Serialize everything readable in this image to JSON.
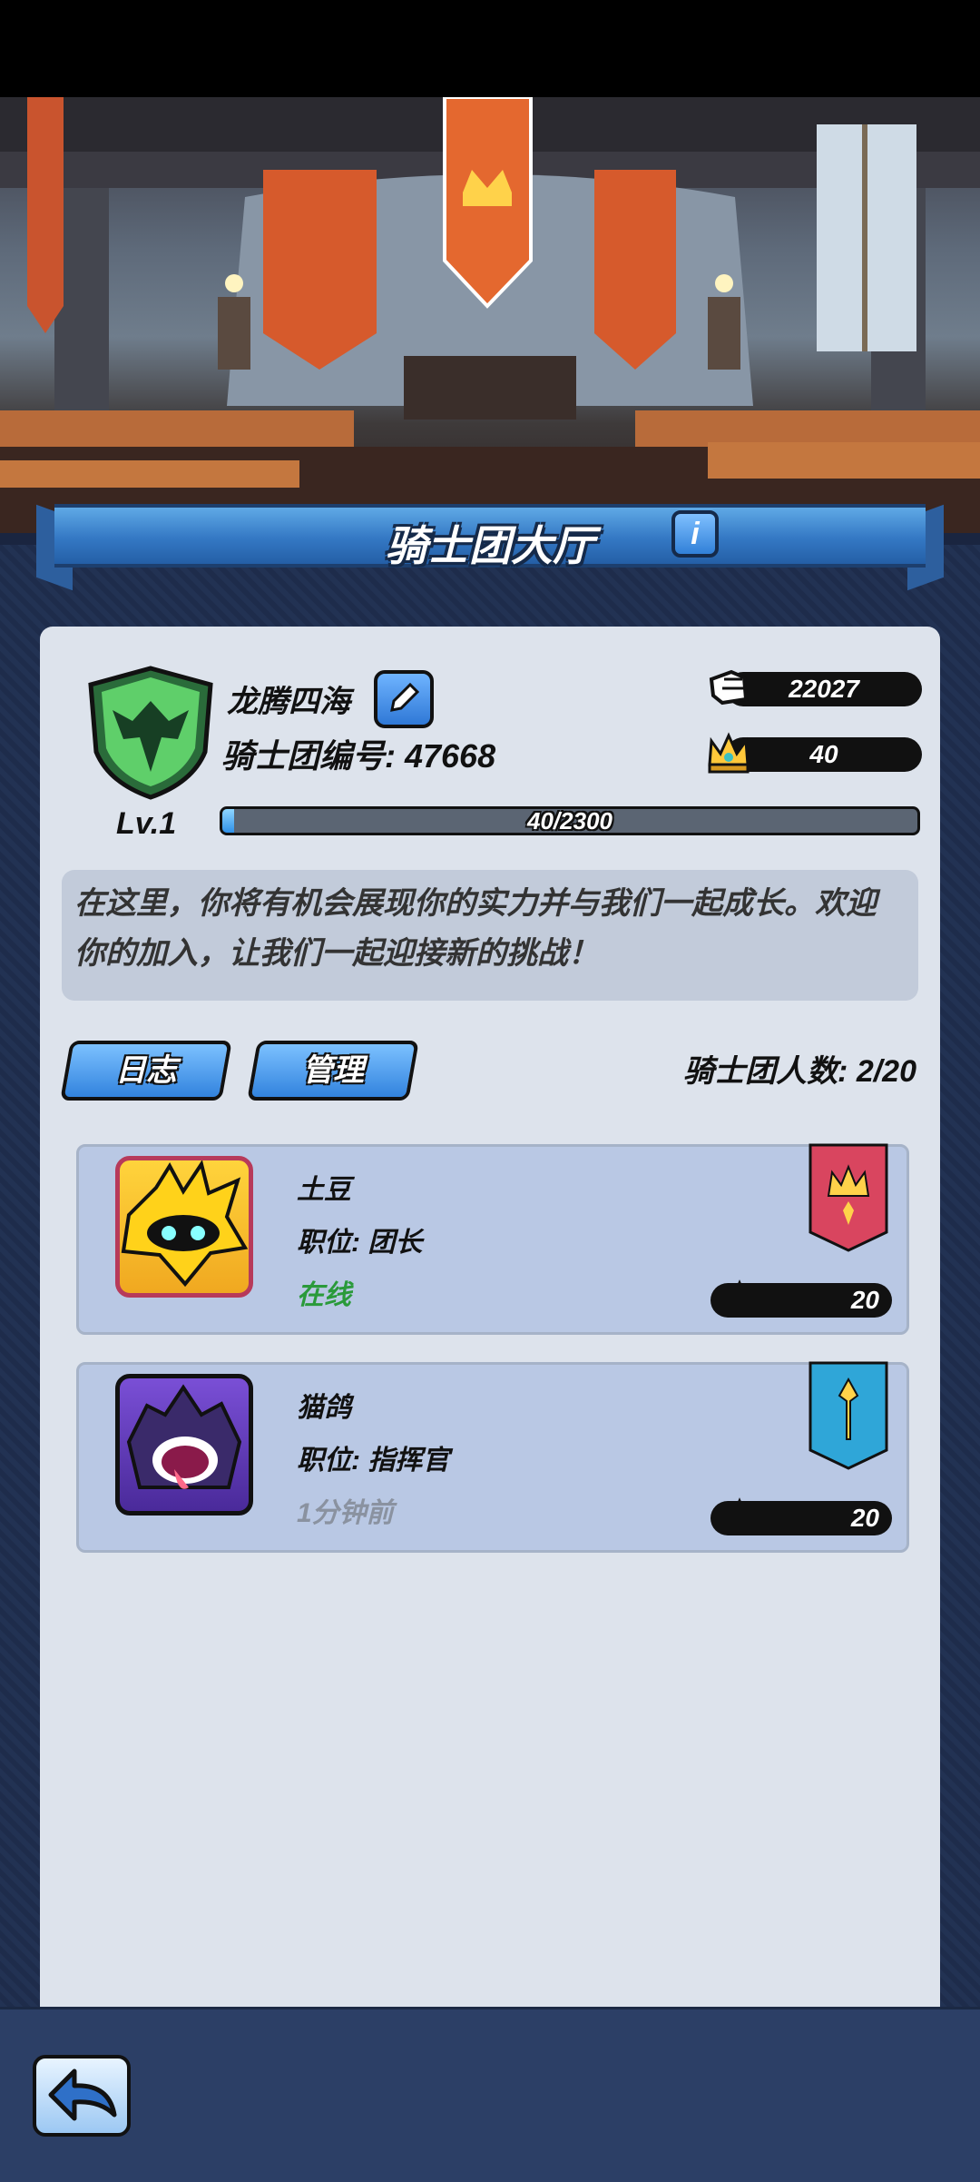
{
  "header": {
    "title": "骑士团大厅"
  },
  "guild": {
    "name": "龙腾四海",
    "id_label": "骑士团编号: 47668",
    "level": "Lv.1",
    "power": "22027",
    "crowns": "40",
    "xp_text": "40/2300",
    "xp_progress": 0.017,
    "description": "在这里，你将有机会展现你的实力并与我们一起成长。欢迎你的加入，让我们一起迎接新的挑战！"
  },
  "tabs": {
    "log": "日志",
    "manage": "管理"
  },
  "member_count": "骑士团人数: 2/20",
  "members": [
    {
      "name": "土豆",
      "role": "职位: 团长",
      "status": "在线",
      "status_color": "#2a9a3a",
      "crowns": "20",
      "banner": "crown-banner-icon"
    },
    {
      "name": "猫鸽",
      "role": "职位: 指挥官",
      "status": "1分钟前",
      "status_color": "#8a92a0",
      "crowns": "20",
      "banner": "sword-banner-icon"
    }
  ],
  "colors": {
    "accent": "#3283de",
    "panel": "#dde3ec",
    "card": "#b9c8e4"
  }
}
